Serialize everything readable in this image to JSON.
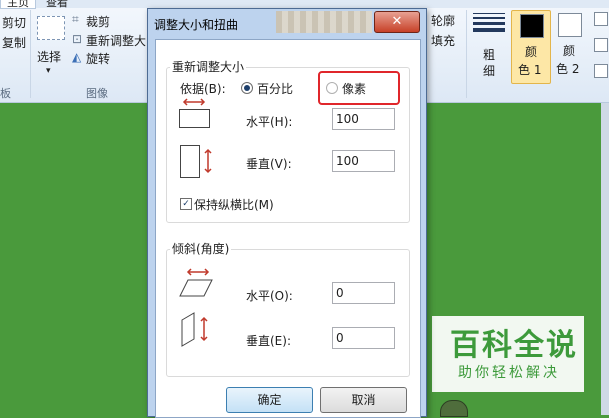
{
  "ribbon": {
    "tabs": [
      "主页",
      "查看"
    ],
    "clipboard": {
      "cut": "剪切",
      "copy": "复制",
      "group_label_partial": "板"
    },
    "image": {
      "select": "选择",
      "crop": "裁剪",
      "resize": "重新调整大",
      "rotate": "旋转",
      "group_label": "图像"
    },
    "shapes": {
      "outline": "轮廓",
      "fill": "填充"
    },
    "size": {
      "label": "粗\n细",
      "label_line1": "粗",
      "label_line2": "细"
    },
    "color1": {
      "line1": "颜",
      "line2": "色 1",
      "color": "#000000"
    },
    "color2": {
      "line1": "颜",
      "line2": "色 2",
      "color": "#ffffff"
    }
  },
  "dialog": {
    "title": "调整大小和扭曲",
    "close_label": "✕",
    "resize": {
      "legend": "重新调整大小",
      "by_label": "依据(B):",
      "percent_label": "百分比",
      "pixels_label": "像素",
      "selected": "percent",
      "horizontal_label": "水平(H):",
      "horizontal_value": "100",
      "vertical_label": "垂直(V):",
      "vertical_value": "100",
      "keep_ratio_label": "保持纵横比(M)",
      "keep_ratio_checked": true
    },
    "skew": {
      "legend": "倾斜(角度)",
      "horizontal_label": "水平(O):",
      "horizontal_value": "0",
      "vertical_label": "垂直(E):",
      "vertical_value": "0"
    },
    "ok_label": "确定",
    "cancel_label": "取消"
  },
  "watermark": {
    "title": "百科全说",
    "subtitle": "助你轻松解决"
  },
  "colors": {
    "canvas": "#4a9a3c",
    "highlight": "#e0262b",
    "watermark": "#3d9a3b"
  }
}
